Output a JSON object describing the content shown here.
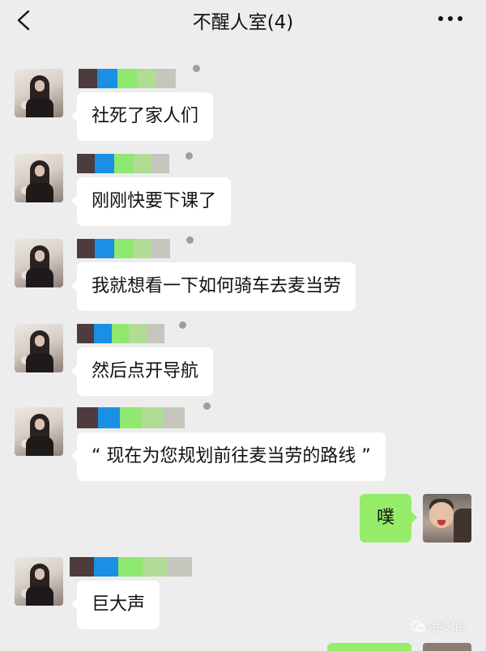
{
  "header": {
    "title": "不醒人室(4)"
  },
  "messages": [
    {
      "text": "社死了家人们"
    },
    {
      "text": "刚刚快要下课了"
    },
    {
      "text": "我就想看一下如何骑车去麦当劳"
    },
    {
      "text": "然后点开导航"
    },
    {
      "text": "“ 现在为您规划前往麦当劳的路线 ”"
    },
    {
      "text": "巨大声"
    }
  ],
  "my_message": {
    "text": "噗"
  },
  "watermark": {
    "text": "哈婆娘i"
  },
  "colors": {
    "background": "#ededed",
    "incoming_bubble": "#ffffff",
    "outgoing_bubble": "#95ec69"
  },
  "icons": [
    "back-icon",
    "more-icon",
    "wechat-watermark-icon"
  ]
}
